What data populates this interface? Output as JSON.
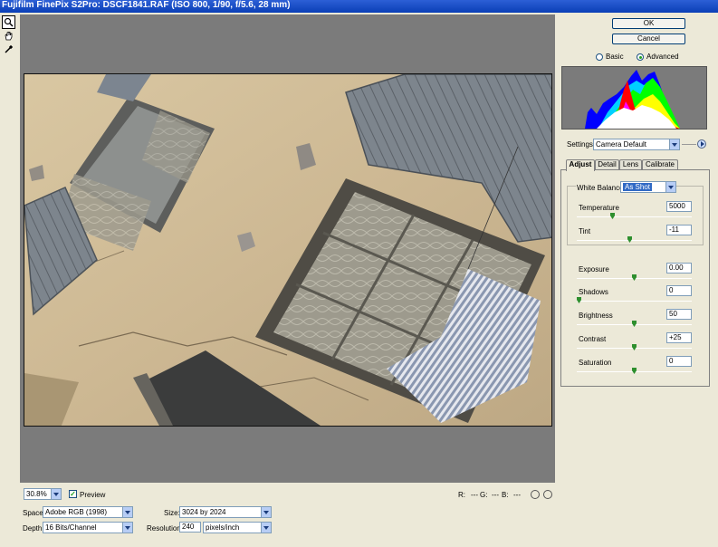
{
  "window": {
    "title": "Fujifilm FinePix S2Pro:  DSCF1841.RAF  (ISO 800, 1/90, f/5.6, 28 mm)"
  },
  "tools": [
    "zoom-tool",
    "hand-tool",
    "white-balance-tool"
  ],
  "buttons": {
    "ok": "OK",
    "cancel": "Cancel"
  },
  "mode": {
    "basic": "Basic",
    "advanced": "Advanced",
    "selected": "advanced"
  },
  "settings": {
    "label": "Settings:",
    "value": "Camera Default"
  },
  "tabs": [
    {
      "label": "Adjust",
      "active": true
    },
    {
      "label": "Detail",
      "active": false
    },
    {
      "label": "Lens",
      "active": false
    },
    {
      "label": "Calibrate",
      "active": false
    }
  ],
  "white_balance": {
    "label": "White Balance:",
    "value": "As Shot"
  },
  "adjust": {
    "temperature": {
      "label": "Temperature",
      "value": "5000",
      "level": 0.3
    },
    "tint": {
      "label": "Tint",
      "value": "-11",
      "level": 0.46
    },
    "exposure": {
      "label": "Exposure",
      "value": "0.00",
      "level": 0.5
    },
    "shadows": {
      "label": "Shadows",
      "value": "0",
      "level": 0.0
    },
    "brightness": {
      "label": "Brightness",
      "value": "50",
      "level": 0.5
    },
    "contrast": {
      "label": "Contrast",
      "value": "+25",
      "level": 0.5
    },
    "saturation": {
      "label": "Saturation",
      "value": "0",
      "level": 0.5
    }
  },
  "status": {
    "zoom": "30.8%",
    "preview_label": "Preview",
    "r_label": "R:",
    "r_value": "---",
    "g_label": "G:",
    "g_value": "---",
    "b_label": "B:",
    "b_value": "---"
  },
  "workflow": {
    "space_label": "Space:",
    "space_value": "Adobe RGB (1998)",
    "depth_label": "Depth:",
    "depth_value": "16 Bits/Channel",
    "size_label": "Size:",
    "size_value": "3024 by 2024",
    "resolution_label": "Resolution:",
    "resolution_value": "240",
    "resolution_unit": "pixels/inch"
  },
  "colors": {
    "accent": "#316ac5",
    "canvas_bg": "#7b7b7b",
    "slider_thumb": "#2e8f2e"
  }
}
